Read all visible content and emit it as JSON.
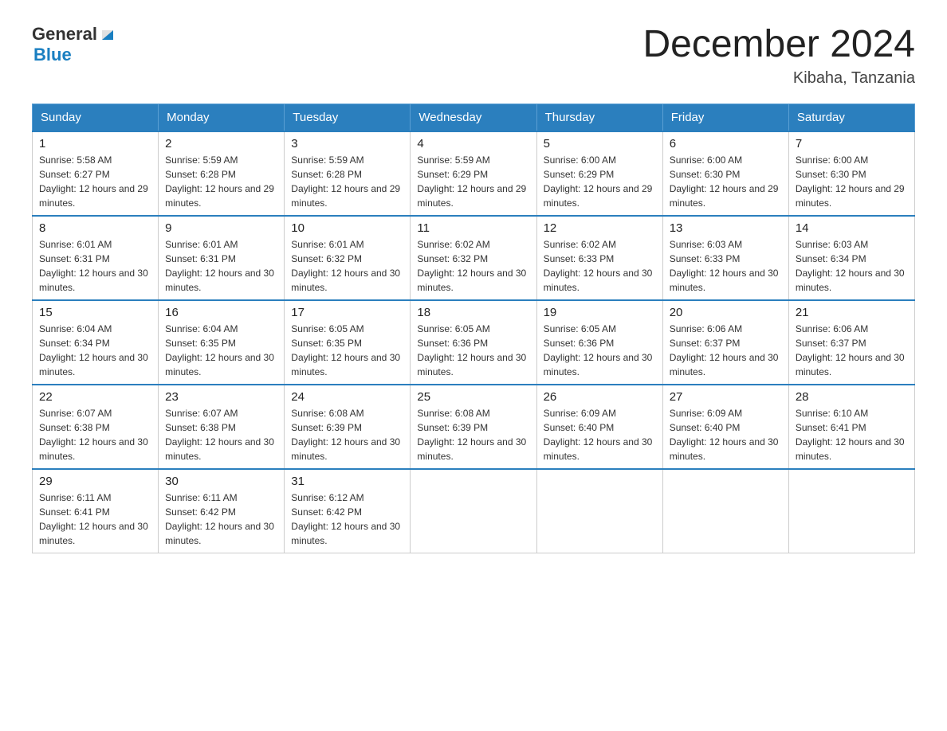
{
  "header": {
    "logo_general": "General",
    "logo_blue": "Blue",
    "month_title": "December 2024",
    "location": "Kibaha, Tanzania"
  },
  "weekdays": [
    "Sunday",
    "Monday",
    "Tuesday",
    "Wednesday",
    "Thursday",
    "Friday",
    "Saturday"
  ],
  "weeks": [
    [
      {
        "day": "1",
        "sunrise": "Sunrise: 5:58 AM",
        "sunset": "Sunset: 6:27 PM",
        "daylight": "Daylight: 12 hours and 29 minutes."
      },
      {
        "day": "2",
        "sunrise": "Sunrise: 5:59 AM",
        "sunset": "Sunset: 6:28 PM",
        "daylight": "Daylight: 12 hours and 29 minutes."
      },
      {
        "day": "3",
        "sunrise": "Sunrise: 5:59 AM",
        "sunset": "Sunset: 6:28 PM",
        "daylight": "Daylight: 12 hours and 29 minutes."
      },
      {
        "day": "4",
        "sunrise": "Sunrise: 5:59 AM",
        "sunset": "Sunset: 6:29 PM",
        "daylight": "Daylight: 12 hours and 29 minutes."
      },
      {
        "day": "5",
        "sunrise": "Sunrise: 6:00 AM",
        "sunset": "Sunset: 6:29 PM",
        "daylight": "Daylight: 12 hours and 29 minutes."
      },
      {
        "day": "6",
        "sunrise": "Sunrise: 6:00 AM",
        "sunset": "Sunset: 6:30 PM",
        "daylight": "Daylight: 12 hours and 29 minutes."
      },
      {
        "day": "7",
        "sunrise": "Sunrise: 6:00 AM",
        "sunset": "Sunset: 6:30 PM",
        "daylight": "Daylight: 12 hours and 29 minutes."
      }
    ],
    [
      {
        "day": "8",
        "sunrise": "Sunrise: 6:01 AM",
        "sunset": "Sunset: 6:31 PM",
        "daylight": "Daylight: 12 hours and 30 minutes."
      },
      {
        "day": "9",
        "sunrise": "Sunrise: 6:01 AM",
        "sunset": "Sunset: 6:31 PM",
        "daylight": "Daylight: 12 hours and 30 minutes."
      },
      {
        "day": "10",
        "sunrise": "Sunrise: 6:01 AM",
        "sunset": "Sunset: 6:32 PM",
        "daylight": "Daylight: 12 hours and 30 minutes."
      },
      {
        "day": "11",
        "sunrise": "Sunrise: 6:02 AM",
        "sunset": "Sunset: 6:32 PM",
        "daylight": "Daylight: 12 hours and 30 minutes."
      },
      {
        "day": "12",
        "sunrise": "Sunrise: 6:02 AM",
        "sunset": "Sunset: 6:33 PM",
        "daylight": "Daylight: 12 hours and 30 minutes."
      },
      {
        "day": "13",
        "sunrise": "Sunrise: 6:03 AM",
        "sunset": "Sunset: 6:33 PM",
        "daylight": "Daylight: 12 hours and 30 minutes."
      },
      {
        "day": "14",
        "sunrise": "Sunrise: 6:03 AM",
        "sunset": "Sunset: 6:34 PM",
        "daylight": "Daylight: 12 hours and 30 minutes."
      }
    ],
    [
      {
        "day": "15",
        "sunrise": "Sunrise: 6:04 AM",
        "sunset": "Sunset: 6:34 PM",
        "daylight": "Daylight: 12 hours and 30 minutes."
      },
      {
        "day": "16",
        "sunrise": "Sunrise: 6:04 AM",
        "sunset": "Sunset: 6:35 PM",
        "daylight": "Daylight: 12 hours and 30 minutes."
      },
      {
        "day": "17",
        "sunrise": "Sunrise: 6:05 AM",
        "sunset": "Sunset: 6:35 PM",
        "daylight": "Daylight: 12 hours and 30 minutes."
      },
      {
        "day": "18",
        "sunrise": "Sunrise: 6:05 AM",
        "sunset": "Sunset: 6:36 PM",
        "daylight": "Daylight: 12 hours and 30 minutes."
      },
      {
        "day": "19",
        "sunrise": "Sunrise: 6:05 AM",
        "sunset": "Sunset: 6:36 PM",
        "daylight": "Daylight: 12 hours and 30 minutes."
      },
      {
        "day": "20",
        "sunrise": "Sunrise: 6:06 AM",
        "sunset": "Sunset: 6:37 PM",
        "daylight": "Daylight: 12 hours and 30 minutes."
      },
      {
        "day": "21",
        "sunrise": "Sunrise: 6:06 AM",
        "sunset": "Sunset: 6:37 PM",
        "daylight": "Daylight: 12 hours and 30 minutes."
      }
    ],
    [
      {
        "day": "22",
        "sunrise": "Sunrise: 6:07 AM",
        "sunset": "Sunset: 6:38 PM",
        "daylight": "Daylight: 12 hours and 30 minutes."
      },
      {
        "day": "23",
        "sunrise": "Sunrise: 6:07 AM",
        "sunset": "Sunset: 6:38 PM",
        "daylight": "Daylight: 12 hours and 30 minutes."
      },
      {
        "day": "24",
        "sunrise": "Sunrise: 6:08 AM",
        "sunset": "Sunset: 6:39 PM",
        "daylight": "Daylight: 12 hours and 30 minutes."
      },
      {
        "day": "25",
        "sunrise": "Sunrise: 6:08 AM",
        "sunset": "Sunset: 6:39 PM",
        "daylight": "Daylight: 12 hours and 30 minutes."
      },
      {
        "day": "26",
        "sunrise": "Sunrise: 6:09 AM",
        "sunset": "Sunset: 6:40 PM",
        "daylight": "Daylight: 12 hours and 30 minutes."
      },
      {
        "day": "27",
        "sunrise": "Sunrise: 6:09 AM",
        "sunset": "Sunset: 6:40 PM",
        "daylight": "Daylight: 12 hours and 30 minutes."
      },
      {
        "day": "28",
        "sunrise": "Sunrise: 6:10 AM",
        "sunset": "Sunset: 6:41 PM",
        "daylight": "Daylight: 12 hours and 30 minutes."
      }
    ],
    [
      {
        "day": "29",
        "sunrise": "Sunrise: 6:11 AM",
        "sunset": "Sunset: 6:41 PM",
        "daylight": "Daylight: 12 hours and 30 minutes."
      },
      {
        "day": "30",
        "sunrise": "Sunrise: 6:11 AM",
        "sunset": "Sunset: 6:42 PM",
        "daylight": "Daylight: 12 hours and 30 minutes."
      },
      {
        "day": "31",
        "sunrise": "Sunrise: 6:12 AM",
        "sunset": "Sunset: 6:42 PM",
        "daylight": "Daylight: 12 hours and 30 minutes."
      },
      null,
      null,
      null,
      null
    ]
  ]
}
